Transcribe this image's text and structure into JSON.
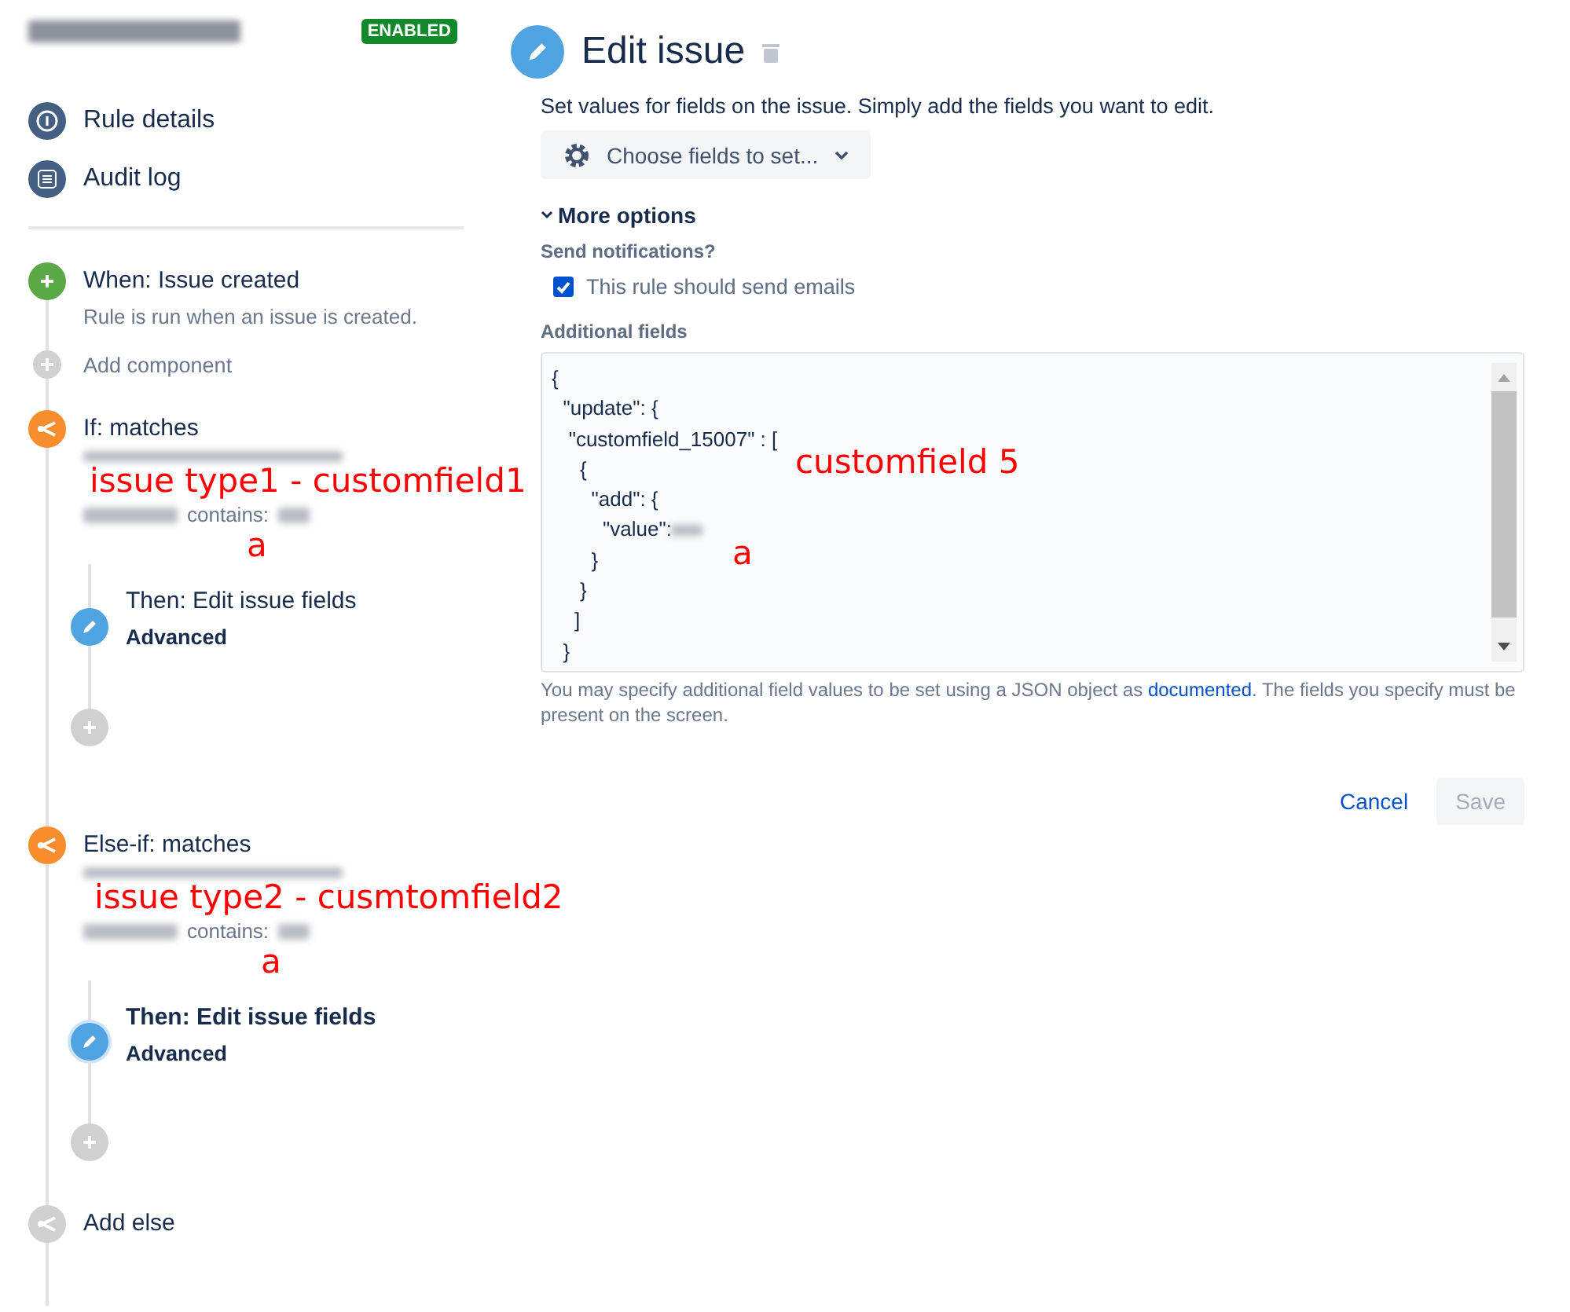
{
  "rule": {
    "status": "ENABLED"
  },
  "nav": [
    {
      "kind": "info",
      "label": "Rule details"
    },
    {
      "kind": "log",
      "label": "Audit log"
    }
  ],
  "components": [
    {
      "kind": "trigger",
      "title": "When: Issue created",
      "description": "Rule is run when an issue is created."
    },
    {
      "kind": "add",
      "label": "Add component"
    },
    {
      "kind": "condition",
      "title": "If: matches",
      "contains_label": "contains:",
      "children": [
        {
          "kind": "action",
          "title": "Then: Edit issue fields",
          "subtitle": "Advanced",
          "selected": false
        },
        {
          "kind": "add"
        }
      ]
    },
    {
      "kind": "condition",
      "title": "Else-if: matches",
      "contains_label": "contains:",
      "children": [
        {
          "kind": "action",
          "title": "Then: Edit issue fields",
          "subtitle": "Advanced",
          "selected": true
        },
        {
          "kind": "add"
        }
      ]
    },
    {
      "kind": "add_else",
      "label": "Add else"
    }
  ],
  "editor": {
    "title": "Edit issue",
    "description": "Set values for fields on the issue. Simply add the fields you want to edit.",
    "choose_button": "Choose fields to set...",
    "more_options": "More options",
    "notifications_label": "Send notifications?",
    "send_emails": {
      "label": "This rule should send emails",
      "checked": true
    },
    "additional_fields_label": "Additional fields",
    "code_lines": [
      {
        "text": "{"
      },
      {
        "text": "  \"update\": {"
      },
      {
        "text": "   \"customfield_15007\" : ["
      },
      {
        "text": "     {"
      },
      {
        "text": "       \"add\": {"
      },
      {
        "text": "         \"value\":",
        "redacted": true
      },
      {
        "text": "       }"
      },
      {
        "text": "     }"
      },
      {
        "text": "    ]"
      },
      {
        "text": "  }"
      }
    ],
    "help": {
      "before": "You may specify additional field values to be set using a JSON object as ",
      "link": "documented",
      "after": ". The fields you specify must be present on the screen."
    },
    "cancel": "Cancel",
    "save": {
      "label": "Save",
      "disabled": true
    }
  },
  "annotations": [
    {
      "text": "issue type1  -  customfield1"
    },
    {
      "text": "a"
    },
    {
      "text": "customfield  5"
    },
    {
      "text": "a"
    },
    {
      "text": "issue type2  -  cusmtomfield2"
    },
    {
      "text": "a"
    }
  ]
}
